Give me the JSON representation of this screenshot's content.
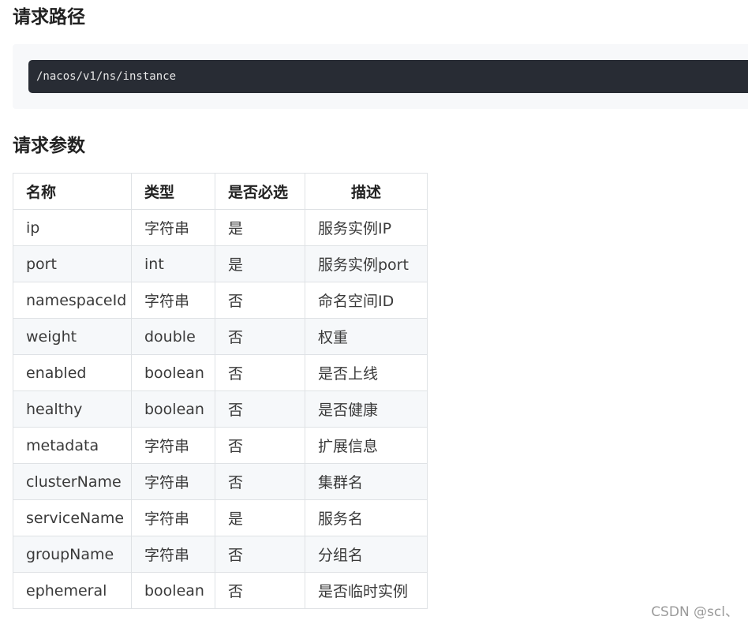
{
  "sections": {
    "path_heading": "请求路径",
    "params_heading": "请求参数"
  },
  "request_path": "/nacos/v1/ns/instance",
  "table": {
    "headers": [
      "名称",
      "类型",
      "是否必选",
      "描述"
    ],
    "rows": [
      [
        "ip",
        "字符串",
        "是",
        "服务实例IP"
      ],
      [
        "port",
        "int",
        "是",
        "服务实例port"
      ],
      [
        "namespaceId",
        "字符串",
        "否",
        "命名空间ID"
      ],
      [
        "weight",
        "double",
        "否",
        "权重"
      ],
      [
        "enabled",
        "boolean",
        "否",
        "是否上线"
      ],
      [
        "healthy",
        "boolean",
        "否",
        "是否健康"
      ],
      [
        "metadata",
        "字符串",
        "否",
        "扩展信息"
      ],
      [
        "clusterName",
        "字符串",
        "否",
        "集群名"
      ],
      [
        "serviceName",
        "字符串",
        "是",
        "服务名"
      ],
      [
        "groupName",
        "字符串",
        "否",
        "分组名"
      ],
      [
        "ephemeral",
        "boolean",
        "否",
        "是否临时实例"
      ]
    ]
  },
  "watermark": "CSDN @scl、"
}
